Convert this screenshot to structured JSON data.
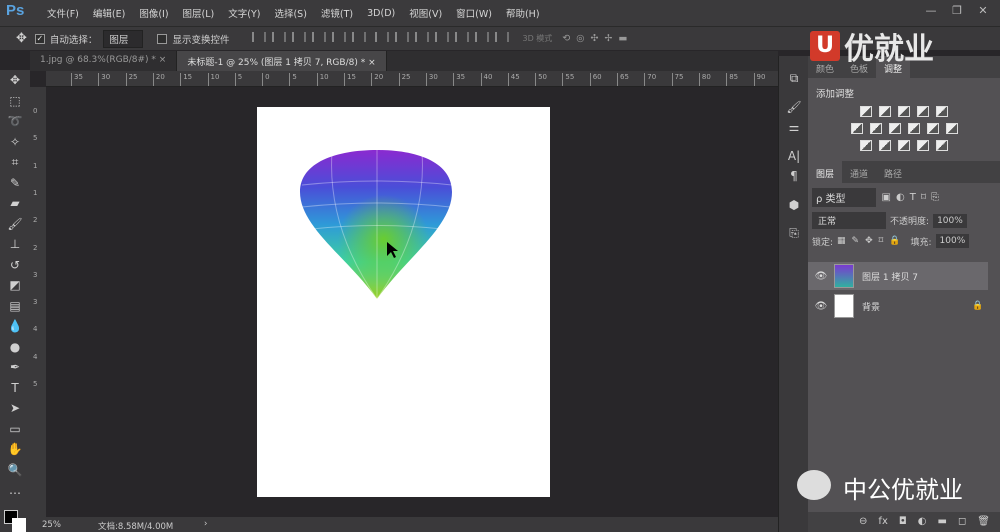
{
  "app": {
    "logo": "Ps",
    "menus": [
      "文件(F)",
      "编辑(E)",
      "图像(I)",
      "图层(L)",
      "文字(Y)",
      "选择(S)",
      "滤镜(T)",
      "3D(D)",
      "视图(V)",
      "窗口(W)",
      "帮助(H)"
    ],
    "window_buttons": [
      "—",
      "❐",
      "✕"
    ]
  },
  "options": {
    "auto_select_label": "自动选择：",
    "auto_select_checked": true,
    "auto_select_target": "图层",
    "show_transform_label": "显示变换控件",
    "mode_3d": "3D 模式"
  },
  "tabs": [
    {
      "label": "1.jpg @ 68.3%(RGB/8#) *",
      "close": "×"
    },
    {
      "label": "未标题-1 @ 25% (图层 1 拷贝 7, RGB/8) *",
      "close": "×"
    }
  ],
  "ruler": {
    "h_ticks": [
      "35",
      "30",
      "25",
      "20",
      "15",
      "10",
      "5",
      "0",
      "5",
      "10",
      "15",
      "20",
      "25",
      "30",
      "35",
      "40",
      "45",
      "50",
      "55",
      "60",
      "65",
      "70",
      "75",
      "80",
      "85",
      "90"
    ],
    "v_ticks": [
      "0",
      "5",
      "1",
      "1",
      "2",
      "2",
      "3",
      "3",
      "4",
      "4",
      "5"
    ]
  },
  "status": {
    "zoom": "25%",
    "doc": "文档:8.58M/4.00M",
    "arrow": "›"
  },
  "panels": {
    "top_tabs": [
      "颜色",
      "色板",
      "调整"
    ],
    "adjust_title": "添加调整",
    "layer_tabs": [
      "图层",
      "通道",
      "路径"
    ],
    "filter": "ρ 类型",
    "blend_mode": "正常",
    "opacity_label": "不透明度:",
    "opacity": "100%",
    "lock_label": "锁定:",
    "fill_label": "填充:",
    "fill": "100%",
    "layers": [
      {
        "name": "图层 1 拷贝 7",
        "selected": true
      },
      {
        "name": "背景",
        "locked": true
      }
    ],
    "bottom_icons": [
      "⊖",
      "fx",
      "◘",
      "◐",
      "▬",
      "◻",
      "🗑"
    ]
  },
  "watermark": {
    "brand": "优就业",
    "brand_u": "U",
    "bottom": "中公优就业"
  }
}
